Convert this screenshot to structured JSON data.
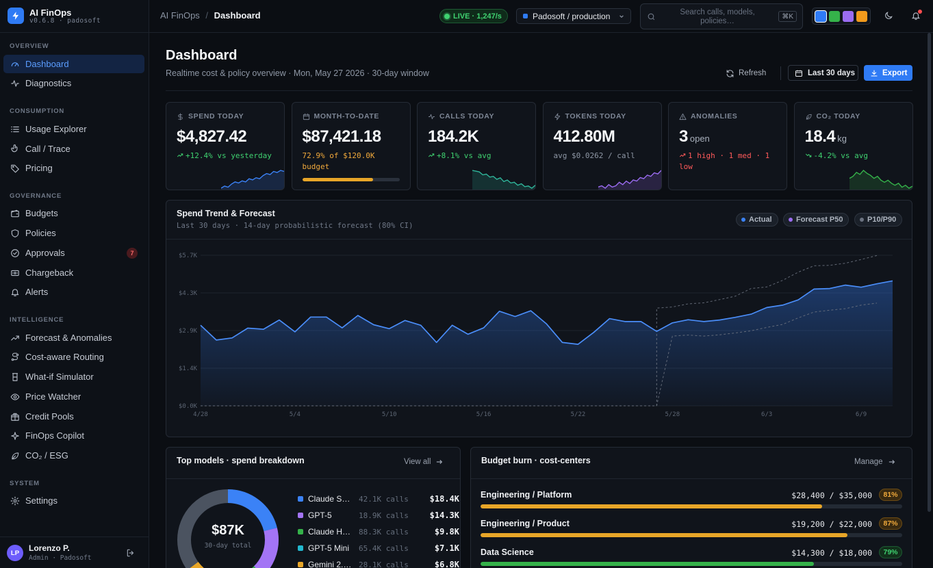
{
  "brand": {
    "name": "AI FinOps",
    "version": "v0.6.8 · padosoft"
  },
  "sidebar": {
    "sections": [
      {
        "title": "OVERVIEW",
        "items": [
          {
            "label": "Dashboard",
            "icon": "gauge-icon",
            "active": true
          },
          {
            "label": "Diagnostics",
            "icon": "pulse-icon"
          }
        ]
      },
      {
        "title": "CONSUMPTION",
        "items": [
          {
            "label": "Usage Explorer",
            "icon": "list-icon"
          },
          {
            "label": "Call / Trace",
            "icon": "pointer-icon"
          },
          {
            "label": "Pricing",
            "icon": "tag-icon"
          }
        ]
      },
      {
        "title": "GOVERNANCE",
        "items": [
          {
            "label": "Budgets",
            "icon": "wallet-icon"
          },
          {
            "label": "Policies",
            "icon": "shield-icon"
          },
          {
            "label": "Approvals",
            "icon": "check-circle-icon",
            "badge": "7"
          },
          {
            "label": "Chargeback",
            "icon": "receipt-icon"
          },
          {
            "label": "Alerts",
            "icon": "bell-icon"
          }
        ]
      },
      {
        "title": "INTELLIGENCE",
        "items": [
          {
            "label": "Forecast & Anomalies",
            "icon": "trend-icon"
          },
          {
            "label": "Cost-aware Routing",
            "icon": "route-icon"
          },
          {
            "label": "What-if Simulator",
            "icon": "flask-icon"
          },
          {
            "label": "Price Watcher",
            "icon": "eye-icon"
          },
          {
            "label": "Credit Pools",
            "icon": "gift-icon"
          },
          {
            "label": "FinOps Copilot",
            "icon": "sparkle-icon"
          },
          {
            "label": "CO₂ / ESG",
            "icon": "leaf-icon"
          }
        ]
      },
      {
        "title": "SYSTEM",
        "items": [
          {
            "label": "Settings",
            "icon": "gear-icon"
          }
        ]
      }
    ],
    "user": {
      "initials": "LP",
      "name": "Lorenzo P.",
      "role": "Admin · Padosoft"
    }
  },
  "topbar": {
    "breadcrumb": [
      "AI FinOps",
      "Dashboard"
    ],
    "live": "LIVE · 1,247/s",
    "org": "Padosoft / production",
    "search_placeholder": "Search calls, models, policies…",
    "shortcut": "⌘K",
    "themes": [
      "#2f7bf5",
      "#35b24a",
      "#9b6cf2",
      "#f29a1c"
    ]
  },
  "page": {
    "title": "Dashboard",
    "subtitle": "Realtime cost & policy overview · Mon, May 27 2026 · 30-day window",
    "refresh": "Refresh",
    "range": "Last 30 days",
    "export": "Export"
  },
  "kpis": [
    {
      "label": "SPEND TODAY",
      "icon": "dollar-icon",
      "value": "$4,827.42",
      "unit": "",
      "sub": "+12.4% vs yesterday",
      "tone": "up",
      "spark_color": "#3b82f6",
      "spark": [
        8,
        10,
        9,
        12,
        14,
        13,
        15,
        14,
        17,
        16,
        18,
        17,
        20,
        22,
        21,
        24,
        23,
        25,
        24
      ]
    },
    {
      "label": "MONTH-TO-DATE",
      "icon": "calendar-icon",
      "value": "$87,421.18",
      "unit": "",
      "sub": "72.9% of $120.0K budget",
      "tone": "warn",
      "progress": 0.729
    },
    {
      "label": "CALLS TODAY",
      "icon": "pulse-icon",
      "value": "184.2K",
      "unit": "",
      "sub": "+8.1% vs avg",
      "tone": "up",
      "spark_color": "#2fb59a",
      "spark": [
        30,
        29,
        28,
        24,
        25,
        21,
        22,
        18,
        20,
        15,
        17,
        13,
        14,
        10,
        12,
        8,
        9,
        6,
        10
      ]
    },
    {
      "label": "TOKENS TODAY",
      "icon": "bolt-icon",
      "value": "412.80M",
      "unit": "",
      "sub": "avg $0.0262 / call",
      "tone": "muted",
      "spark_color": "#9b6cf2",
      "spark": [
        8,
        9,
        7,
        10,
        8,
        9,
        12,
        10,
        13,
        11,
        14,
        13,
        16,
        15,
        18,
        17,
        20,
        19,
        22
      ]
    },
    {
      "label": "ANOMALIES",
      "icon": "warning-icon",
      "value": "3",
      "unit": "open",
      "sub": "1 high · 1 med · 1 low",
      "tone": "bad"
    },
    {
      "label": "CO₂ TODAY",
      "icon": "leaf-icon",
      "value": "18.4",
      "unit": "kg",
      "sub": "-4.2% vs avg",
      "tone": "down",
      "spark_color": "#35b24a",
      "spark": [
        22,
        24,
        28,
        26,
        30,
        27,
        25,
        22,
        24,
        20,
        18,
        20,
        17,
        15,
        17,
        13,
        15,
        12,
        14
      ]
    }
  ],
  "trend": {
    "title": "Spend Trend & Forecast",
    "subtitle": "Last 30 days · 14-day probabilistic forecast (80% CI)",
    "legend": [
      {
        "label": "Actual",
        "color": "#3b82f6"
      },
      {
        "label": "Forecast P50",
        "color": "#9b6cf2"
      },
      {
        "label": "P10/P90",
        "color": "#6b7280"
      }
    ]
  },
  "chart_data": {
    "type": "area",
    "title": "Spend Trend & Forecast",
    "y_tick_labels": [
      "$0.0K",
      "$1.4K",
      "$2.9K",
      "$4.3K",
      "$5.7K"
    ],
    "ylim": [
      0,
      5700
    ],
    "x_tick_labels": [
      "4/28",
      "5/4",
      "5/10",
      "5/16",
      "5/22",
      "5/28",
      "6/3",
      "6/9"
    ],
    "x_tick_index": [
      0,
      6,
      12,
      18,
      24,
      30,
      36,
      42
    ],
    "grid": true,
    "series": [
      {
        "name": "Actual",
        "values": [
          3050,
          2490,
          2570,
          2940,
          2900,
          3250,
          2800,
          3360,
          3360,
          2950,
          3420,
          3070,
          2920,
          3230,
          3050,
          2400,
          3050,
          2710,
          2950,
          3580,
          3380,
          3600,
          3100,
          2400,
          2330,
          2780,
          3300,
          3190,
          3190,
          2820,
          3140,
          3260,
          3190,
          3250,
          3350,
          3470,
          3720,
          3810,
          4010,
          4420,
          4440,
          4570,
          4490,
          4620,
          4730
        ]
      },
      {
        "name": "P90",
        "start_index": 29,
        "values": [
          3700,
          3740,
          3860,
          3900,
          4020,
          4150,
          4440,
          4500,
          4750,
          5060,
          5300,
          5320,
          5400,
          5540,
          5690
        ]
      },
      {
        "name": "P10",
        "start_index": 29,
        "values": [
          0,
          2640,
          2680,
          2640,
          2690,
          2760,
          2840,
          2970,
          3080,
          3330,
          3550,
          3620,
          3680,
          3810,
          3890
        ]
      }
    ]
  },
  "models": {
    "title": "Top models · spend breakdown",
    "link": "View all",
    "donut_value": "$87K",
    "donut_label": "30-day total",
    "items": [
      {
        "name": "Claude S…",
        "calls": "42.1K calls",
        "cost": "$18.4K",
        "color": "#3b82f6",
        "share": 18.4
      },
      {
        "name": "GPT-5",
        "calls": "18.9K calls",
        "cost": "$14.3K",
        "color": "#a374f5",
        "share": 14.3
      },
      {
        "name": "Claude H…",
        "calls": "88.3K calls",
        "cost": "$9.8K",
        "color": "#35b24a",
        "share": 9.8
      },
      {
        "name": "GPT-5 Mini",
        "calls": "65.4K calls",
        "cost": "$7.1K",
        "color": "#22b8cf",
        "share": 7.1
      },
      {
        "name": "Gemini 2.…",
        "calls": "28.1K calls",
        "cost": "$6.8K",
        "color": "#e8a628",
        "share": 6.8
      }
    ],
    "remainder_color": "#4b5360"
  },
  "budgets": {
    "title": "Budget burn · cost-centers",
    "link": "Manage",
    "items": [
      {
        "name": "Engineering / Platform",
        "amount": "$28,400 / $35,000",
        "pct": "81%",
        "fill": 0.81,
        "tone": "warn"
      },
      {
        "name": "Engineering / Product",
        "amount": "$19,200 / $22,000",
        "pct": "87%",
        "fill": 0.87,
        "tone": "warn"
      },
      {
        "name": "Data Science",
        "amount": "$14,300 / $18,000",
        "pct": "79%",
        "fill": 0.79,
        "tone": "good"
      }
    ]
  }
}
